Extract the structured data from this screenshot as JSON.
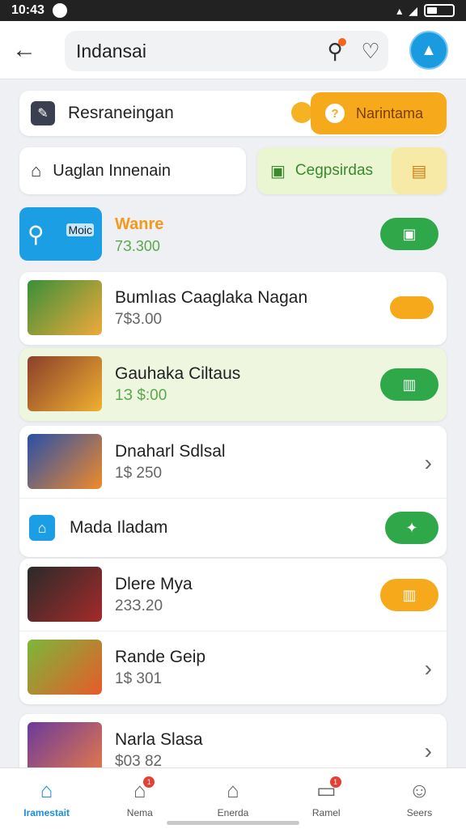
{
  "status": {
    "time": "10:43"
  },
  "header": {
    "search_query": "Indansai"
  },
  "shortcuts": {
    "row1_label": "Resraneingan",
    "row1_button": "Narintama",
    "row2_left": "Uaglan Innenain",
    "row2_right": "Cegpsirdas"
  },
  "featured": {
    "tag": "Moic",
    "title": "Wanre",
    "price": "7З.300"
  },
  "games": [
    {
      "name": "Bumlıas Caaglaka Nagan",
      "price": "7$3.00",
      "action": "toggle",
      "colors": [
        "#3a8f3a",
        "#f0a93a"
      ]
    },
    {
      "name": "Gauhaka Ciltaus",
      "price": "1З $:00",
      "action": "green",
      "colors": [
        "#8a3f2a",
        "#f0b030"
      ]
    },
    {
      "name": "Dnaharl Sdlsal",
      "price": "1$ 250",
      "action": "chevron",
      "colors": [
        "#2850a8",
        "#f08a2a"
      ]
    }
  ],
  "home_item": {
    "name": "Mada Iladam"
  },
  "games2": [
    {
      "name": "Dlere Mya",
      "price": "23З.20",
      "action": "orange",
      "colors": [
        "#2a2a2a",
        "#a62a2a"
      ]
    },
    {
      "name": "Rande Geip",
      "price": "1$ 301",
      "action": "chevron",
      "colors": [
        "#7ab83a",
        "#e85a2a"
      ]
    }
  ],
  "games3": [
    {
      "name": "Narla Slasa",
      "price": "$03 82",
      "action": "chevron",
      "colors": [
        "#6a3a9a",
        "#e87a4a"
      ]
    }
  ],
  "nav": [
    {
      "label": "Iramestait",
      "icon": "home-icon",
      "active": true
    },
    {
      "label": "Nema",
      "icon": "store-icon",
      "badge": "1"
    },
    {
      "label": "Enerda",
      "icon": "bank-icon"
    },
    {
      "label": "Ramel",
      "icon": "chat-icon",
      "badge": "1"
    },
    {
      "label": "Seers",
      "icon": "profile-icon"
    }
  ],
  "colors": {
    "accent": "#1c9ee5",
    "green": "#2fa84a",
    "orange": "#f7a91c"
  }
}
